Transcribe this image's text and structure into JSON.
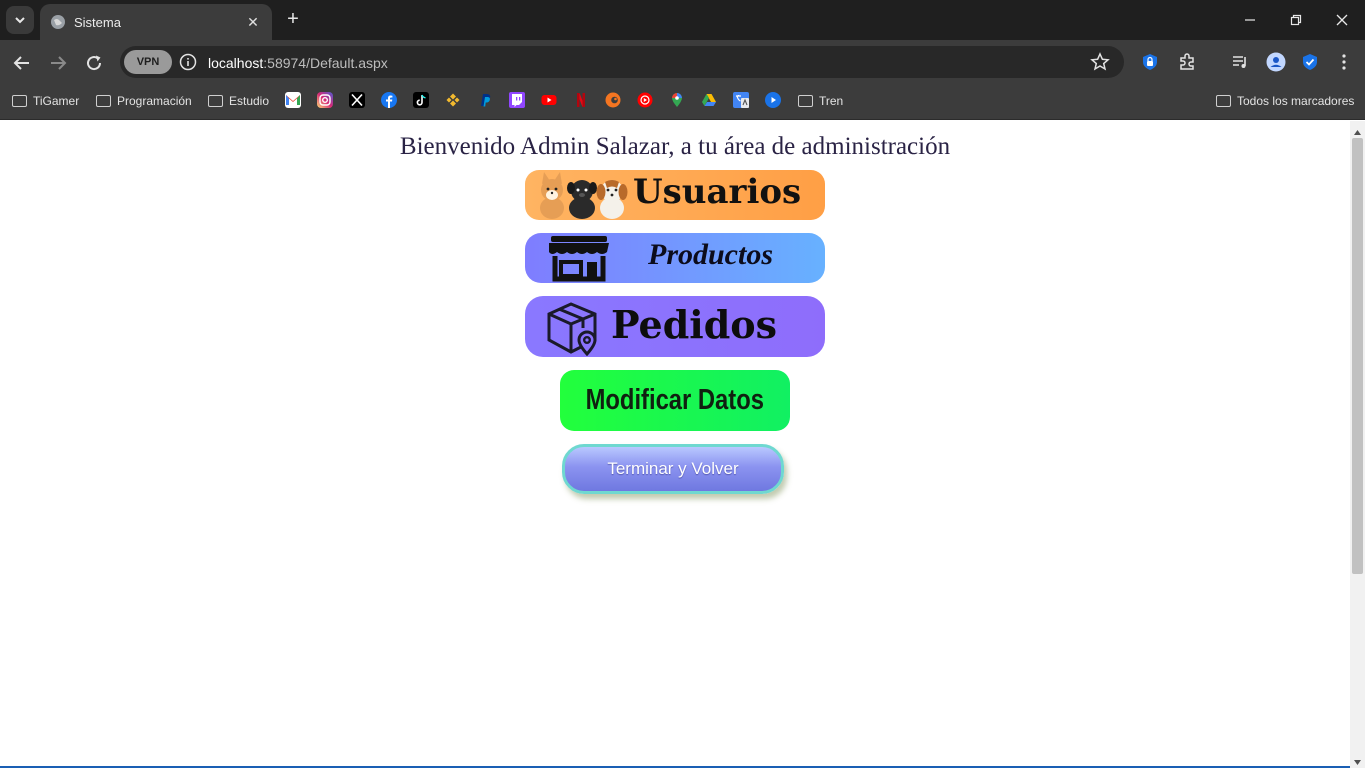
{
  "browser": {
    "tab_title": "Sistema",
    "vpn_label": "VPN",
    "url_host": "localhost",
    "url_rest": ":58974/Default.aspx",
    "bookmarks": [
      {
        "label": "TiGamer"
      },
      {
        "label": "Programación"
      },
      {
        "label": "Estudio"
      },
      {
        "label": "Tren"
      }
    ],
    "all_bookmarks_label": "Todos los marcadores"
  },
  "page": {
    "heading": "Bienvenido Admin Salazar, a tu área de administración",
    "buttons": {
      "usuarios": "Usuarios",
      "productos": "Productos",
      "pedidos": "Pedidos",
      "modificar": "Modificar Datos",
      "terminar": "Terminar y Volver"
    }
  },
  "colors": {
    "usuarios": "#ffa54f",
    "productos": "#7496ff",
    "pedidos": "#8a72fd",
    "modificar": "#1afc4f",
    "terminar": "#8b93f0"
  }
}
